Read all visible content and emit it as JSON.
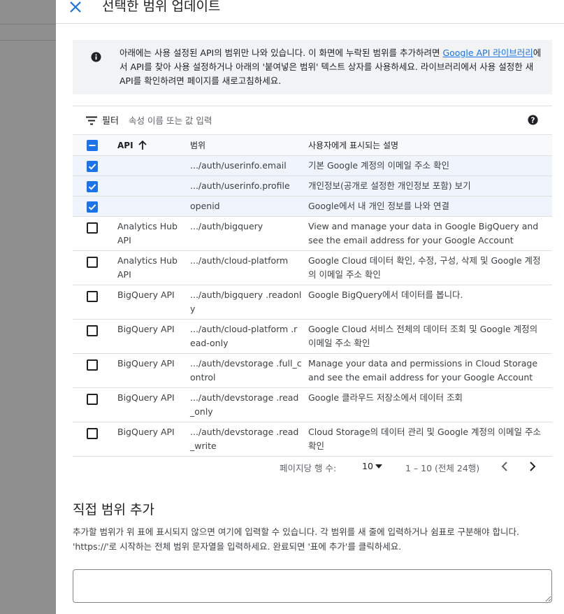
{
  "dialog": {
    "title": "선택한 범위 업데이트"
  },
  "info": {
    "text_before_link": "아래에는 사용 설정된 API의 범위만 나와 있습니다. 이 화면에 누락된 범위를 추가하려면 ",
    "link_label": "Google API 라이브러리",
    "text_after_link": "에서 API를 찾아 사용 설정하거나 아래의 '붙여넣은 범위' 텍스트 상자를 사용하세요. 라이브러리에서 사용 설정한 새 API를 확인하려면 페이지를 새로고침하세요."
  },
  "filter": {
    "label": "필터",
    "placeholder": "속성 이름 또는 값 입력"
  },
  "table": {
    "headers": {
      "api": "API",
      "scope": "범위",
      "description": "사용자에게 표시되는 설명"
    },
    "rows": [
      {
        "checked": true,
        "api": "",
        "scope": ".../auth/userinfo.email",
        "description": "기본 Google 계정의 이메일 주소 확인"
      },
      {
        "checked": true,
        "api": "",
        "scope": ".../auth/userinfo.profile",
        "description": "개인정보(공개로 설정한 개인정보 포함) 보기"
      },
      {
        "checked": true,
        "api": "",
        "scope": "openid",
        "description": "Google에서 내 개인 정보를 나와 연결"
      },
      {
        "checked": false,
        "api": "Analytics Hub API",
        "scope": ".../auth/bigquery",
        "description": "View and manage your data in Google BigQuery and see the email address for your Google Account"
      },
      {
        "checked": false,
        "api": "Analytics Hub API",
        "scope": ".../auth/cloud-platform",
        "description": "Google Cloud 데이터 확인, 수정, 구성, 삭제 및 Google 계정의 이메일 주소 확인"
      },
      {
        "checked": false,
        "api": "BigQuery API",
        "scope": ".../auth/bigquery .readonly",
        "description": "Google BigQuery에서 데이터를 봅니다."
      },
      {
        "checked": false,
        "api": "BigQuery API",
        "scope": ".../auth/cloud-platform .read-only",
        "description": "Google Cloud 서비스 전체의 데이터 조회 및 Google 계정의 이메일 주소 확인"
      },
      {
        "checked": false,
        "api": "BigQuery API",
        "scope": ".../auth/devstorage .full_control",
        "description": "Manage your data and permissions in Cloud Storage and see the email address for your Google Account"
      },
      {
        "checked": false,
        "api": "BigQuery API",
        "scope": ".../auth/devstorage .read_only",
        "description": "Google 클라우드 저장소에서 데이터 조회"
      },
      {
        "checked": false,
        "api": "BigQuery API",
        "scope": ".../auth/devstorage .read_write",
        "description": "Cloud Storage의 데이터 관리 및 Google 계정의 이메일 주소 확인"
      }
    ]
  },
  "pagination": {
    "rows_per_page_label": "페이지당 행 수:",
    "rows_per_page": "10",
    "range": "1 – 10 (전체 24행)"
  },
  "manual": {
    "title": "직접 범위 추가",
    "description": "추가할 범위가 위 표에 표시되지 않으면 여기에 입력할 수 있습니다. 각 범위를 새 줄에 입력하거나 쉼표로 구분해야 합니다. 'https://'로 시작하는 전체 범위 문자열을 입력하세요. 완료되면 '표에 추가'를 클릭하세요."
  },
  "colors": {
    "accent": "#1a73e8",
    "selected_row": "#f0f4fc",
    "banner": "#f1f3f4"
  },
  "icons": [
    "close-icon",
    "info-icon",
    "filter-icon",
    "help-icon",
    "sort-arrow-up-icon",
    "checkbox-icon",
    "dropdown-arrow-icon",
    "chevron-left-icon",
    "chevron-right-icon"
  ]
}
